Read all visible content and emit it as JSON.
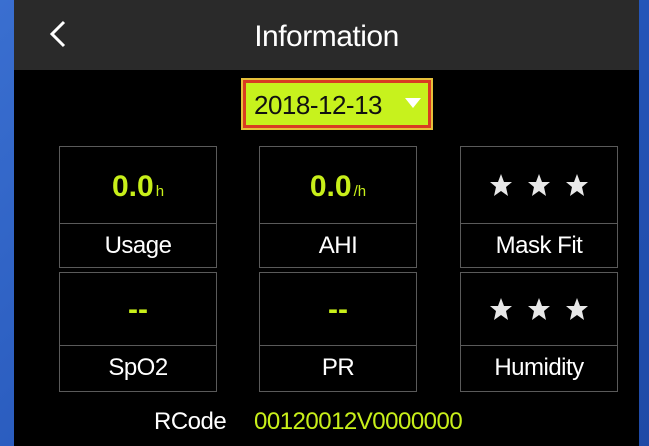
{
  "header": {
    "title": "Information",
    "back_icon": "chevron-left-icon"
  },
  "date_select": {
    "value": "2018-12-13",
    "icon": "triangle-down-icon"
  },
  "tiles": [
    {
      "value": "0.0",
      "unit": "h",
      "label": "Usage"
    },
    {
      "value": "0.0",
      "unit": "/h",
      "label": "AHI"
    },
    {
      "stars": 3,
      "label": "Mask Fit"
    },
    {
      "value": "--",
      "unit": "",
      "label": "SpO2"
    },
    {
      "value": "--",
      "unit": "",
      "label": "PR"
    },
    {
      "stars": 3,
      "label": "Humidity"
    }
  ],
  "rcode": {
    "label": "RCode",
    "value": "00120012V0000000"
  },
  "colors": {
    "accent_value": "#c8ef1a",
    "date_background": "#c7f21d",
    "date_border": "#d93c22",
    "header_background": "#2a2a2a",
    "screen_background": "#000000",
    "bezel": "#2d62c4"
  }
}
